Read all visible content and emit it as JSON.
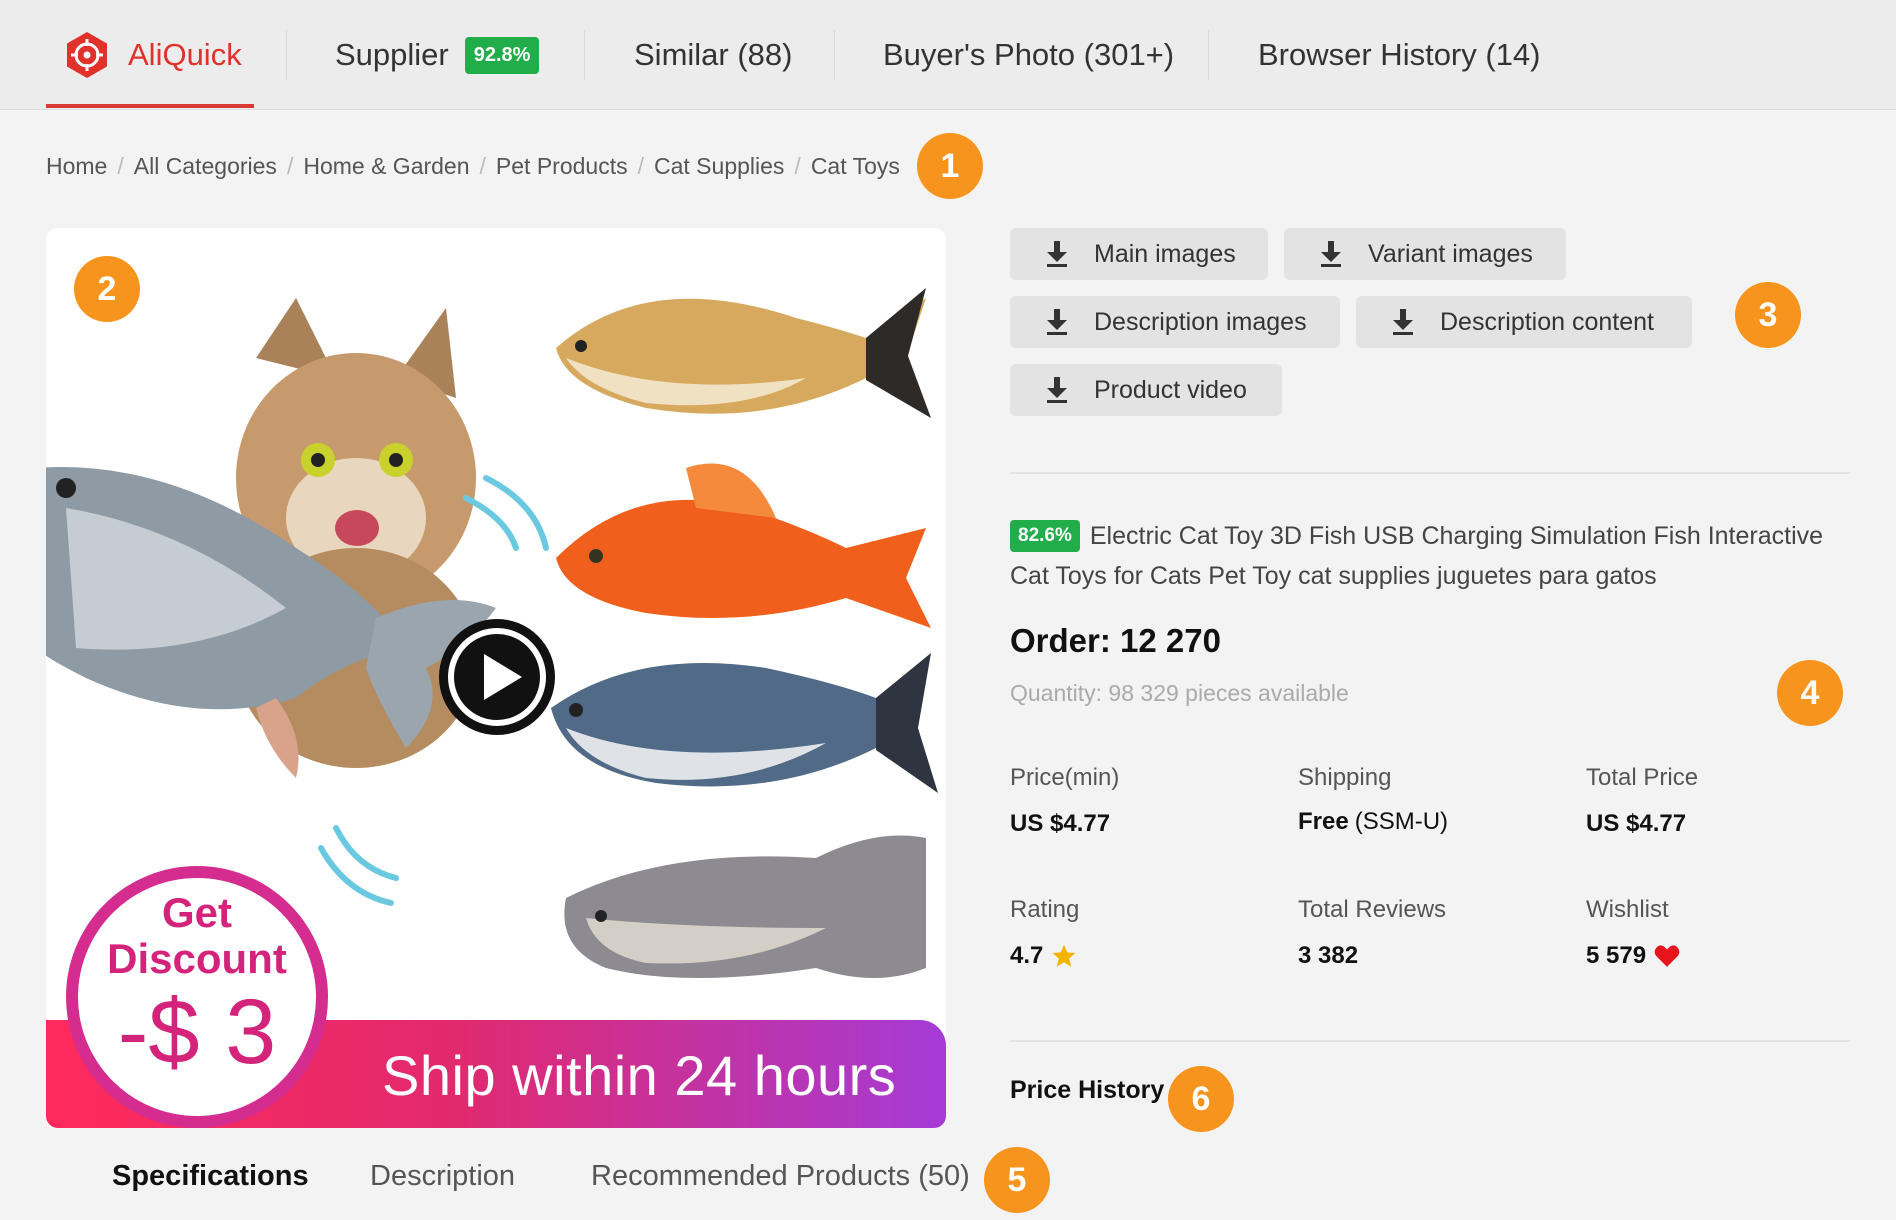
{
  "nav": {
    "brand": "AliQuick",
    "supplier_label": "Supplier",
    "supplier_score": "92.8%",
    "similar": "Similar (88)",
    "buyer_photo": "Buyer's Photo (301+)",
    "browser_history": "Browser History (14)",
    "accent_color": "#e0312a"
  },
  "breadcrumb": [
    "Home",
    "All Categories",
    "Home & Garden",
    "Pet Products",
    "Cat Supplies",
    "Cat Toys"
  ],
  "markers": [
    "1",
    "2",
    "3",
    "4",
    "5",
    "6"
  ],
  "image": {
    "discount_line1": "Get",
    "discount_line2": "Discount",
    "discount_amount": "-$ 3",
    "ship_text": "Ship within 24 hours"
  },
  "downloads": {
    "main_images": "Main images",
    "variant_images": "Variant images",
    "description_images": "Description images",
    "description_content": "Description content",
    "product_video": "Product video",
    "icon": "download-icon"
  },
  "product": {
    "score_badge": "82.6%",
    "title": "Electric Cat Toy 3D Fish USB Charging Simulation Fish Interactive Cat Toys for Cats Pet Toy cat supplies juguetes para gatos",
    "order": "Order: 12 270",
    "quantity": "Quantity: 98 329 pieces available"
  },
  "stats": {
    "price_label": "Price(min)",
    "price_value": "US $4.77",
    "shipping_label": "Shipping",
    "shipping_value": "Free",
    "shipping_method": "(SSM-U)",
    "total_label": "Total Price",
    "total_value": "US $4.77",
    "rating_label": "Rating",
    "rating_value": "4.7",
    "reviews_label": "Total Reviews",
    "reviews_value": "3 382",
    "wishlist_label": "Wishlist",
    "wishlist_value": "5 579"
  },
  "price_history": "Price History",
  "tabs": {
    "specifications": "Specifications",
    "description": "Description",
    "recommended": "Recommended Products (50)"
  }
}
